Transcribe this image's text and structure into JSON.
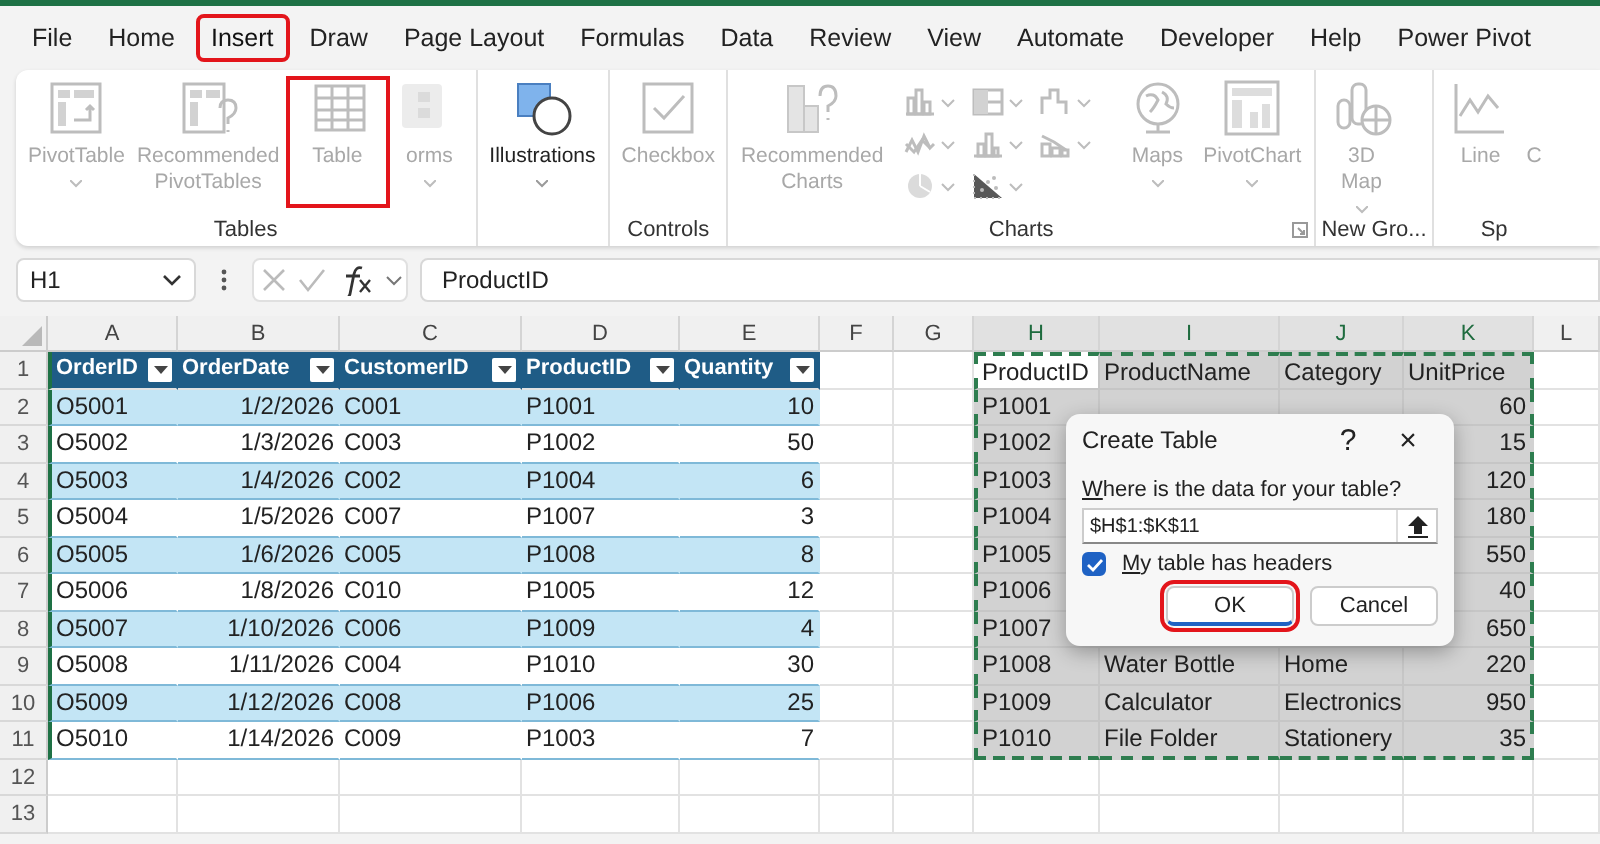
{
  "menu_tabs": [
    {
      "label": "File",
      "selected": false,
      "highlighted": false
    },
    {
      "label": "Home",
      "selected": false,
      "highlighted": false
    },
    {
      "label": "Insert",
      "selected": true,
      "highlighted": true
    },
    {
      "label": "Draw",
      "selected": false,
      "highlighted": false
    },
    {
      "label": "Page Layout",
      "selected": false,
      "highlighted": false
    },
    {
      "label": "Formulas",
      "selected": false,
      "highlighted": false
    },
    {
      "label": "Data",
      "selected": false,
      "highlighted": false
    },
    {
      "label": "Review",
      "selected": false,
      "highlighted": false
    },
    {
      "label": "View",
      "selected": false,
      "highlighted": false
    },
    {
      "label": "Automate",
      "selected": false,
      "highlighted": false
    },
    {
      "label": "Developer",
      "selected": false,
      "highlighted": false
    },
    {
      "label": "Help",
      "selected": false,
      "highlighted": false
    },
    {
      "label": "Power Pivot",
      "selected": false,
      "highlighted": false
    }
  ],
  "ribbon": {
    "groups": [
      {
        "label": "Tables",
        "items": [
          {
            "kind": "large",
            "label": "PivotTable",
            "disabled": true,
            "dropdown": true,
            "highlighted": false
          },
          {
            "kind": "large",
            "label": "Recommended\nPivotTables",
            "disabled": true,
            "dropdown": false,
            "highlighted": false
          },
          {
            "kind": "large",
            "label": "Table",
            "disabled": true,
            "dropdown": false,
            "highlighted": true
          },
          {
            "kind": "large",
            "label": "orms",
            "disabled": true,
            "dropdown": true,
            "highlighted": false
          }
        ]
      },
      {
        "items": [
          {
            "kind": "large",
            "label": "Illustrations",
            "disabled": false,
            "dropdown": true,
            "highlighted": false
          }
        ]
      },
      {
        "label": "Controls",
        "items": [
          {
            "kind": "large",
            "label": "Checkbox",
            "disabled": true,
            "dropdown": false,
            "highlighted": false
          }
        ]
      },
      {
        "label": "Charts",
        "launcher": true,
        "items": [
          {
            "kind": "large",
            "label": "Recommended\nCharts",
            "disabled": true,
            "dropdown": false,
            "highlighted": false
          },
          {
            "kind": "chart-grid",
            "disabled": true
          },
          {
            "kind": "large",
            "label": "Maps",
            "disabled": true,
            "dropdown": true,
            "highlighted": false
          },
          {
            "kind": "large",
            "label": "PivotChart",
            "disabled": true,
            "dropdown": true,
            "highlighted": false
          }
        ]
      },
      {
        "label": "New Gro...",
        "items": [
          {
            "kind": "large",
            "label": "3D\nMap",
            "disabled": true,
            "dropdown": true,
            "highlighted": false
          }
        ]
      },
      {
        "label": "Sp",
        "items": [
          {
            "kind": "large",
            "label": "Line",
            "disabled": true,
            "dropdown": false,
            "highlighted": false
          },
          {
            "kind": "large",
            "label": "C",
            "disabled": true,
            "dropdown": false,
            "highlighted": false
          }
        ]
      }
    ]
  },
  "formula_bar": {
    "name_box": "H1",
    "formula": "ProductID"
  },
  "sheet": {
    "columns": [
      {
        "label": "A",
        "selected": false
      },
      {
        "label": "B",
        "selected": false
      },
      {
        "label": "C",
        "selected": false
      },
      {
        "label": "D",
        "selected": false
      },
      {
        "label": "E",
        "selected": false
      },
      {
        "label": "F",
        "selected": false
      },
      {
        "label": "G",
        "selected": false
      },
      {
        "label": "H",
        "selected": true
      },
      {
        "label": "I",
        "selected": true
      },
      {
        "label": "J",
        "selected": true
      },
      {
        "label": "K",
        "selected": true
      },
      {
        "label": "L",
        "selected": false
      }
    ],
    "rows": [
      "1",
      "2",
      "3",
      "4",
      "5",
      "6",
      "7",
      "8",
      "9",
      "10",
      "11",
      "12",
      "13"
    ],
    "order_table": {
      "columns": [
        {
          "label": "OrderID",
          "numeric": false
        },
        {
          "label": "OrderDate",
          "numeric": true
        },
        {
          "label": "CustomerID",
          "numeric": false
        },
        {
          "label": "ProductID",
          "numeric": false
        },
        {
          "label": "Quantity",
          "numeric": true
        }
      ],
      "rows": [
        [
          "O5001",
          "1/2/2026",
          "C001",
          "P1001",
          "10"
        ],
        [
          "O5002",
          "1/3/2026",
          "C003",
          "P1002",
          "50"
        ],
        [
          "O5003",
          "1/4/2026",
          "C002",
          "P1004",
          "6"
        ],
        [
          "O5004",
          "1/5/2026",
          "C007",
          "P1007",
          "3"
        ],
        [
          "O5005",
          "1/6/2026",
          "C005",
          "P1008",
          "8"
        ],
        [
          "O5006",
          "1/8/2026",
          "C010",
          "P1005",
          "12"
        ],
        [
          "O5007",
          "1/10/2026",
          "C006",
          "P1009",
          "4"
        ],
        [
          "O5008",
          "1/11/2026",
          "C004",
          "P1010",
          "30"
        ],
        [
          "O5009",
          "1/12/2026",
          "C008",
          "P1006",
          "25"
        ],
        [
          "O5010",
          "1/14/2026",
          "C009",
          "P1003",
          "7"
        ]
      ]
    },
    "product_range": {
      "columns": [
        {
          "label": "ProductID",
          "numeric": false
        },
        {
          "label": "ProductName",
          "numeric": false
        },
        {
          "label": "Category",
          "numeric": false
        },
        {
          "label": "UnitPrice",
          "numeric": true
        }
      ],
      "rows": [
        [
          "P1001",
          null,
          null,
          "60"
        ],
        [
          "P1002",
          null,
          null,
          "15"
        ],
        [
          "P1003",
          null,
          null,
          "120"
        ],
        [
          "P1004",
          null,
          null,
          "180"
        ],
        [
          "P1005",
          null,
          null,
          "550"
        ],
        [
          "P1006",
          null,
          null,
          "40"
        ],
        [
          "P1007",
          null,
          null,
          "650"
        ],
        [
          "P1008",
          "Water Bottle",
          "Home",
          "220"
        ],
        [
          "P1009",
          "Calculator",
          "Electronics",
          "950"
        ],
        [
          "P1010",
          "File Folder",
          "Stationery",
          "35"
        ]
      ]
    }
  },
  "dialog": {
    "title": "Create Table",
    "help": "?",
    "close": "×",
    "prompt": "Where is the data for your table?",
    "range": "$H$1:$K$11",
    "headers_label": "My table has headers",
    "headers_checked": true,
    "buttons": [
      {
        "label": "OK",
        "default": true,
        "highlighted": true
      },
      {
        "label": "Cancel",
        "default": false,
        "highlighted": false
      }
    ]
  }
}
